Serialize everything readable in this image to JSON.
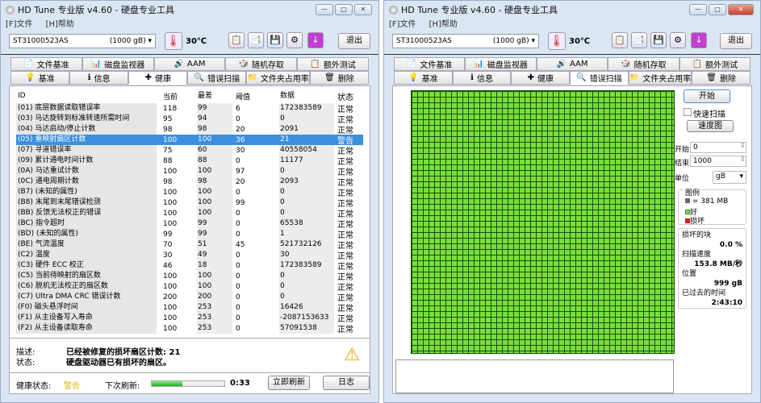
{
  "app": {
    "title": "HD Tune 专业版 v4.60 - 硬盘专业工具",
    "menu": [
      "[F]文件",
      "[H]帮助"
    ],
    "drive": "ST31000523AS",
    "drive_size": "(1000 gB)",
    "temperature": "30℃",
    "exit": "退出",
    "window_buttons": [
      "—",
      "□",
      "✕"
    ]
  },
  "tabs_top": [
    "文件基准",
    "磁盘监视器",
    "AAM",
    "随机存取",
    "额外测试"
  ],
  "tabs_bottom": [
    "基准",
    "信息",
    "健康",
    "错误扫描",
    "文件夹占用率",
    "删除"
  ],
  "tab_icons_top": [
    "📄",
    "📊",
    "🔊",
    "🎲",
    "📋"
  ],
  "tab_icons_bottom": [
    "💡",
    "ℹ",
    "✚",
    "🔍",
    "📁",
    "🗑"
  ],
  "health": {
    "columns": [
      "ID",
      "当前",
      "最差",
      "阈值",
      "数据",
      "状态"
    ],
    "rows": [
      [
        "(01) 底层数据读取错误率",
        "118",
        "99",
        "6",
        "172383589",
        "正常"
      ],
      [
        "(03) 马达旋转到标准转速所需时间",
        "95",
        "94",
        "0",
        "0",
        "正常"
      ],
      [
        "(04) 马达启动/停止计数",
        "98",
        "98",
        "20",
        "2091",
        "正常"
      ],
      [
        "(05) 重映射扇区计数",
        "100",
        "100",
        "36",
        "21",
        "警告"
      ],
      [
        "(07) 寻道错误率",
        "75",
        "60",
        "30",
        "40558054",
        "正常"
      ],
      [
        "(09) 累计通电时间计数",
        "88",
        "88",
        "0",
        "11177",
        "正常"
      ],
      [
        "(0A) 马达重试计数",
        "100",
        "100",
        "97",
        "0",
        "正常"
      ],
      [
        "(0C) 通电周期计数",
        "98",
        "98",
        "20",
        "2093",
        "正常"
      ],
      [
        "(B7) (未知的属性)",
        "100",
        "100",
        "0",
        "0",
        "正常"
      ],
      [
        "(B8) 末尾到末尾错误检测",
        "100",
        "100",
        "99",
        "0",
        "正常"
      ],
      [
        "(BB) 反馈无法校正的错误",
        "100",
        "100",
        "0",
        "0",
        "正常"
      ],
      [
        "(BC) 指令超时",
        "100",
        "99",
        "0",
        "65538",
        "正常"
      ],
      [
        "(BD) (未知的属性)",
        "99",
        "99",
        "0",
        "1",
        "正常"
      ],
      [
        "(BE) 气流温度",
        "70",
        "51",
        "45",
        "521732126",
        "正常"
      ],
      [
        "(C2) 温度",
        "30",
        "49",
        "0",
        "30",
        "正常"
      ],
      [
        "(C3) 硬件 ECC 校正",
        "46",
        "18",
        "0",
        "172383589",
        "正常"
      ],
      [
        "(C5) 当前待映射的扇区数",
        "100",
        "100",
        "0",
        "0",
        "正常"
      ],
      [
        "(C6) 脱机无法校正的扇区数",
        "100",
        "100",
        "0",
        "0",
        "正常"
      ],
      [
        "(C7) Ultra DMA CRC 错误计数",
        "200",
        "200",
        "0",
        "0",
        "正常"
      ],
      [
        "(F0) 磁头悬浮时间",
        "100",
        "253",
        "0",
        "16426",
        "正常"
      ],
      [
        "(F1) 从主设备写入寿命",
        "100",
        "253",
        "0",
        "-2087153633",
        "正常"
      ],
      [
        "(F2) 从主设备读取寿命",
        "100",
        "253",
        "0",
        "57091538",
        "正常"
      ]
    ],
    "selected_row": 3,
    "desc_label": "描述:",
    "desc_value": "已经被修复的损坏扇区计数: 21",
    "state_label": "状态:",
    "state_value": "硬盘驱动器已有损坏的扇区。",
    "health_label": "健康状态:",
    "health_value": "警告",
    "next_label": "下次刷新:",
    "next_time": "0:33",
    "refresh_progress": 0.42,
    "refresh_btn": "立即刷新",
    "log_btn": "日志",
    "warn_color": "#e8b400"
  },
  "scan": {
    "start_btn": "开始",
    "quick_scan": "快速扫描",
    "quick_checked": false,
    "speed_map": "速度图",
    "start_label": "开始",
    "start_value": "0",
    "end_label": "结束",
    "end_value": "1000",
    "unit_label": "单位",
    "unit_value": "gB",
    "legend_title": "图例",
    "legend_block": "= 381 MB",
    "legend_good": "好",
    "legend_bad": "损坏",
    "bad_label": "损坏的块",
    "bad_value": "0.0 %",
    "speed_label": "扫描速度",
    "speed_value": "153.8 MB/秒",
    "pos_label": "位置",
    "pos_value": "999 gB",
    "elapsed_label": "已过去的时间",
    "elapsed_value": "2:43:10",
    "good_color": "#77e03a",
    "bad_color": "#d42020"
  }
}
